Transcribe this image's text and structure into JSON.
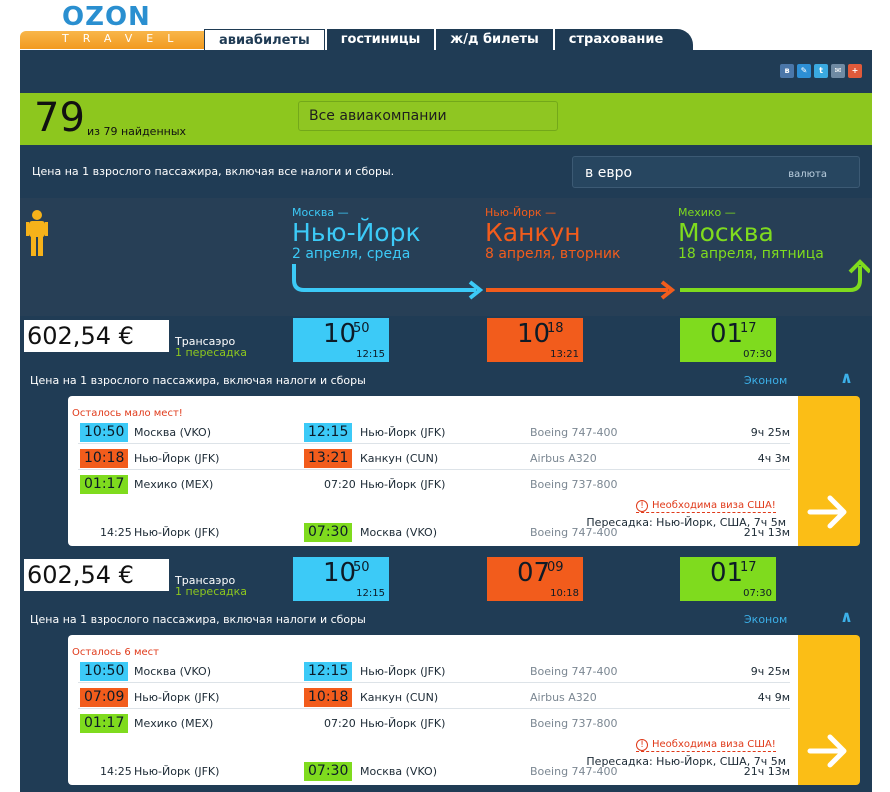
{
  "header": {
    "logo": "OZON",
    "logo_sub": "TRAVEL",
    "tabs": [
      "авиабилеты",
      "гостиницы",
      "ж/д билеты",
      "страхование"
    ],
    "social_icons": [
      "vk-icon",
      "lj-icon",
      "twitter-icon",
      "mail-icon",
      "plus-icon"
    ]
  },
  "search": {
    "count": "79",
    "count_sub": "из 79 найденных",
    "airline_filter": "Все авиакомпании",
    "price_note": "Цена на 1 взрослого пассажира, включая все налоги и сборы.",
    "currency_value": "в евро",
    "currency_label": "валюта"
  },
  "route": [
    {
      "from": "Москва —",
      "to": "Нью-Йорк",
      "date": "2 апреля, среда",
      "color": "#3ccaf7"
    },
    {
      "from": "Нью-Йорк —",
      "to": "Канкун",
      "date": "8 апреля, вторник",
      "color": "#f25c1c"
    },
    {
      "from": "Мехико —",
      "to": "Москва",
      "date": "18 апреля, пятница",
      "color": "#7fdb1e"
    }
  ],
  "flights": [
    {
      "price": "602,54 €",
      "carrier": "Трансаэро",
      "transfers": "1 пересадка",
      "legs": [
        {
          "h": "10",
          "m": "50",
          "arr": "12:15"
        },
        {
          "h": "10",
          "m": "18",
          "arr": "13:21"
        },
        {
          "h": "01",
          "m": "17",
          "arr": "07:30"
        }
      ],
      "fare_note": "Цена на 1 взрослого пассажира, включая налоги и сборы",
      "class": "Эконом",
      "seats_warning": "Осталось мало мест!",
      "segments": [
        {
          "dep": "10:50",
          "from": "Москва (VKO)",
          "arr": "12:15",
          "to": "Нью-Йорк (JFK)",
          "plane": "Boeing 747-400",
          "dur": "9ч 25м"
        },
        {
          "dep": "10:18",
          "from": "Нью-Йорк (JFK)",
          "arr": "13:21",
          "to": "Канкун (CUN)",
          "plane": "Airbus A320",
          "dur": "4ч 3м"
        },
        {
          "dep": "01:17",
          "from": "Мехико (MEX)",
          "arr": "07:20",
          "to": "Нью-Йорк (JFK)",
          "plane": "Boeing 737-800",
          "dur": ""
        },
        {
          "dep": "14:25",
          "from": "Нью-Йорк (JFK)",
          "arr": "07:30",
          "to": "Москва (VKO)",
          "plane": "Boeing 747-400",
          "dur": "21ч 13м"
        }
      ],
      "visa": "Необходима виза США!",
      "transfer_info": "Пересадка: Нью-Йорк, США, 7ч 5м"
    },
    {
      "price": "602,54 €",
      "carrier": "Трансаэро",
      "transfers": "1 пересадка",
      "legs": [
        {
          "h": "10",
          "m": "50",
          "arr": "12:15"
        },
        {
          "h": "07",
          "m": "09",
          "arr": "10:18"
        },
        {
          "h": "01",
          "m": "17",
          "arr": "07:30"
        }
      ],
      "fare_note": "Цена на 1 взрослого пассажира, включая налоги и сборы",
      "class": "Эконом",
      "seats_warning": "Осталось 6 мест",
      "segments": [
        {
          "dep": "10:50",
          "from": "Москва (VKO)",
          "arr": "12:15",
          "to": "Нью-Йорк (JFK)",
          "plane": "Boeing 747-400",
          "dur": "9ч 25м"
        },
        {
          "dep": "07:09",
          "from": "Нью-Йорк (JFK)",
          "arr": "10:18",
          "to": "Канкун (CUN)",
          "plane": "Airbus A320",
          "dur": "4ч 9м"
        },
        {
          "dep": "01:17",
          "from": "Мехико (MEX)",
          "arr": "07:20",
          "to": "Нью-Йорк (JFK)",
          "plane": "Boeing 737-800",
          "dur": ""
        },
        {
          "dep": "14:25",
          "from": "Нью-Йорк (JFK)",
          "arr": "07:30",
          "to": "Москва (VKO)",
          "plane": "Boeing 747-400",
          "dur": "21ч 13м"
        }
      ],
      "visa": "Необходима виза США!",
      "transfer_info": "Пересадка: Нью-Йорк, США, 7ч 5м"
    }
  ]
}
